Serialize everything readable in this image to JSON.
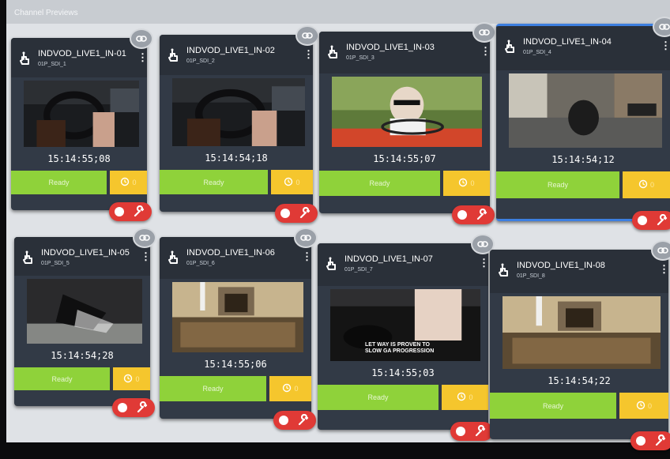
{
  "header": {
    "title": "Channel Previews"
  },
  "channels": [
    {
      "name": "INDVOD_LIVE1_IN-01",
      "source": "01P_SDI_1",
      "timecode": "15:14:55;08",
      "status": "Ready",
      "timer": "0",
      "scene": "car"
    },
    {
      "name": "INDVOD_LIVE1_IN-02",
      "source": "01P_SDI_2",
      "timecode": "15:14:54;18",
      "status": "Ready",
      "timer": "0",
      "scene": "car"
    },
    {
      "name": "INDVOD_LIVE1_IN-03",
      "source": "01P_SDI_3",
      "timecode": "15:14:55;07",
      "status": "Ready",
      "timer": "0",
      "scene": "driver"
    },
    {
      "name": "INDVOD_LIVE1_IN-04",
      "source": "01P_SDI_4",
      "timecode": "15:14:54;12",
      "status": "Ready",
      "timer": "0",
      "scene": "street"
    },
    {
      "name": "INDVOD_LIVE1_IN-05",
      "source": "01P_SDI_5",
      "timecode": "15:14:54;28",
      "status": "Ready",
      "timer": "0",
      "scene": "dark"
    },
    {
      "name": "INDVOD_LIVE1_IN-06",
      "source": "01P_SDI_6",
      "timecode": "15:14:55;06",
      "status": "Ready",
      "timer": "0",
      "scene": "room"
    },
    {
      "name": "INDVOD_LIVE1_IN-07",
      "source": "01P_SDI_7",
      "timecode": "15:14:55;03",
      "status": "Ready",
      "timer": "0",
      "scene": "shoe",
      "overlay_text": "LET WAY IS PROVEN TO\nSLOW GA PROGRESSION"
    },
    {
      "name": "INDVOD_LIVE1_IN-08",
      "source": "01P_SDI_8",
      "timecode": "15:14:54;22",
      "status": "Ready",
      "timer": "0",
      "scene": "room"
    }
  ],
  "colors": {
    "ready": "#8fd23a",
    "timer": "#f5c62d",
    "toggle": "#e03a36",
    "selected": "#3d7fe0"
  }
}
